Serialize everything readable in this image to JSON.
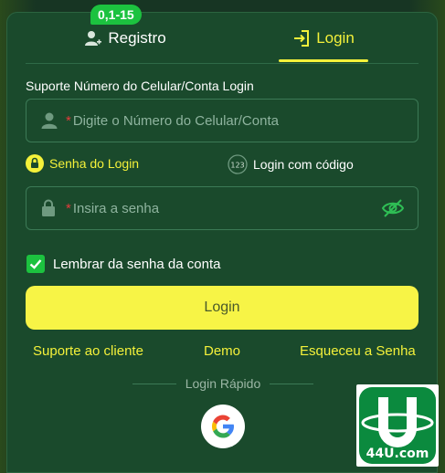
{
  "tabs": {
    "registro_label": "Registro",
    "registro_badge": "0,1-15",
    "login_label": "Login",
    "active": "login"
  },
  "form": {
    "section_title": "Suporte Número do Celular/Conta Login",
    "phone_placeholder": "Digite o Número do Celular/Conta",
    "required_mark": "*",
    "mode_senha_label": "Senha do Login",
    "mode_codigo_label": "Login com código",
    "mode_codigo_icon_text": "123",
    "password_placeholder": "Insira a senha",
    "remember_label": "Lembrar da senha da conta",
    "remember_checked": true,
    "login_button": "Login"
  },
  "links": {
    "suporte": "Suporte ao cliente",
    "demo": "Demo",
    "esqueceu": "Esqueceu a Senha"
  },
  "quick_login": {
    "label": "Login Rápido",
    "provider_icon": "google-icon"
  },
  "watermark": {
    "text": "44U.com"
  },
  "colors": {
    "panel": "#1a4a2c",
    "accent_yellow": "#f4f13a",
    "badge_green": "#1cc23f",
    "button_yellow": "#f7f446"
  }
}
